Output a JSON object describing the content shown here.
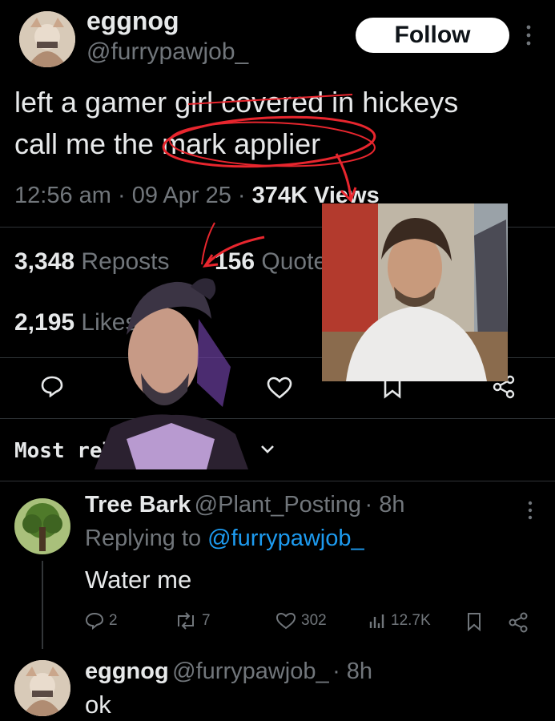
{
  "tweet": {
    "author_name": "eggnog",
    "author_handle": "@furrypawjob_",
    "follow_label": "Follow",
    "text_line1": "left a gamer girl covered in hickeys",
    "text_line2": "call me the mark applier",
    "time": "12:56 am",
    "date": "09 Apr 25",
    "views": "374K Views",
    "reposts_count": "3,348",
    "reposts_label": "Reposts",
    "quotes_count": "156",
    "quotes_label": "Quotes",
    "likes_count": "2,195",
    "likes_label": "Likes"
  },
  "sort": {
    "label": "Most relevant"
  },
  "replies": [
    {
      "name": "Tree Bark",
      "handle": "@Plant_Posting",
      "time": "· 8h",
      "replying_prefix": "Replying to",
      "replying_to": "@furrypawjob_",
      "text": "Water me",
      "stats": {
        "replies": "2",
        "reposts": "7",
        "likes": "302",
        "views": "12.7K"
      }
    },
    {
      "name": "eggnog",
      "handle": "@furrypawjob_",
      "time": "· 8h",
      "text": "ok"
    }
  ],
  "colors": {
    "background": "#000000",
    "text": "#e7e9ea",
    "muted": "#71767b",
    "link": "#1d9bf0",
    "annotation": "#e8262e"
  }
}
